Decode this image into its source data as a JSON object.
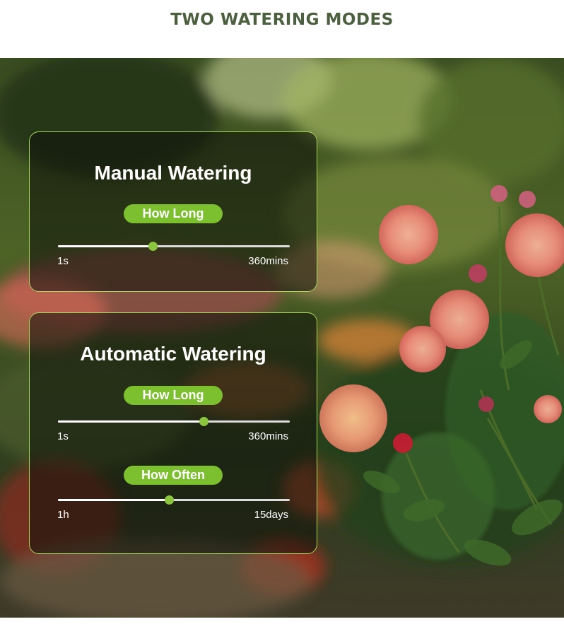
{
  "header": {
    "title": "TWO WATERING MODES"
  },
  "manual": {
    "title": "Manual Watering",
    "how_long": {
      "label": "How Long",
      "min_label": "1s",
      "max_label": "360mins",
      "level": 0.41
    }
  },
  "automatic": {
    "title": "Automatic Watering",
    "how_long": {
      "label": "How Long",
      "min_label": "1s",
      "max_label": "360mins",
      "level": 0.63
    },
    "how_often": {
      "label": "How Often",
      "min_label": "1h",
      "max_label": "15days",
      "level": 0.48
    }
  },
  "colors": {
    "accent": "#7cbf2f",
    "title": "#4c5f3f",
    "border": "#a8d65a"
  },
  "icons": {
    "background": "rose-garden-photo"
  }
}
